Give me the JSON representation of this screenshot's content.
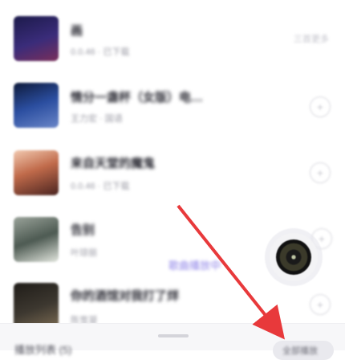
{
  "songs": [
    {
      "title": "画",
      "meta": "0.0.46 · 已下载",
      "action": "三首更多",
      "cover": "#2b2a6a"
    },
    {
      "title": "情分一盏杯（女版）电…",
      "meta": "王力宏 · 国语",
      "action": "+",
      "cover": "#3b4a8a"
    },
    {
      "title": "来自天堂的魔鬼",
      "meta": "0.0.46 · 已下载",
      "action": "+",
      "cover": "#a8543a"
    },
    {
      "title": "告别",
      "meta": "叶琼丽",
      "action": "+",
      "cover": "#6e7a6f"
    },
    {
      "title": "你的酒馆对我打了烊",
      "meta": "陈雪凝",
      "action": "+",
      "cover": "#33302b"
    }
  ],
  "float_tip": "歌曲播放中",
  "bottom": {
    "playlist_label": "播放列表 (5)",
    "pill_label": "全部播放"
  },
  "colors": {
    "arrow": "#e8393b",
    "accent": "#8f84e8"
  }
}
